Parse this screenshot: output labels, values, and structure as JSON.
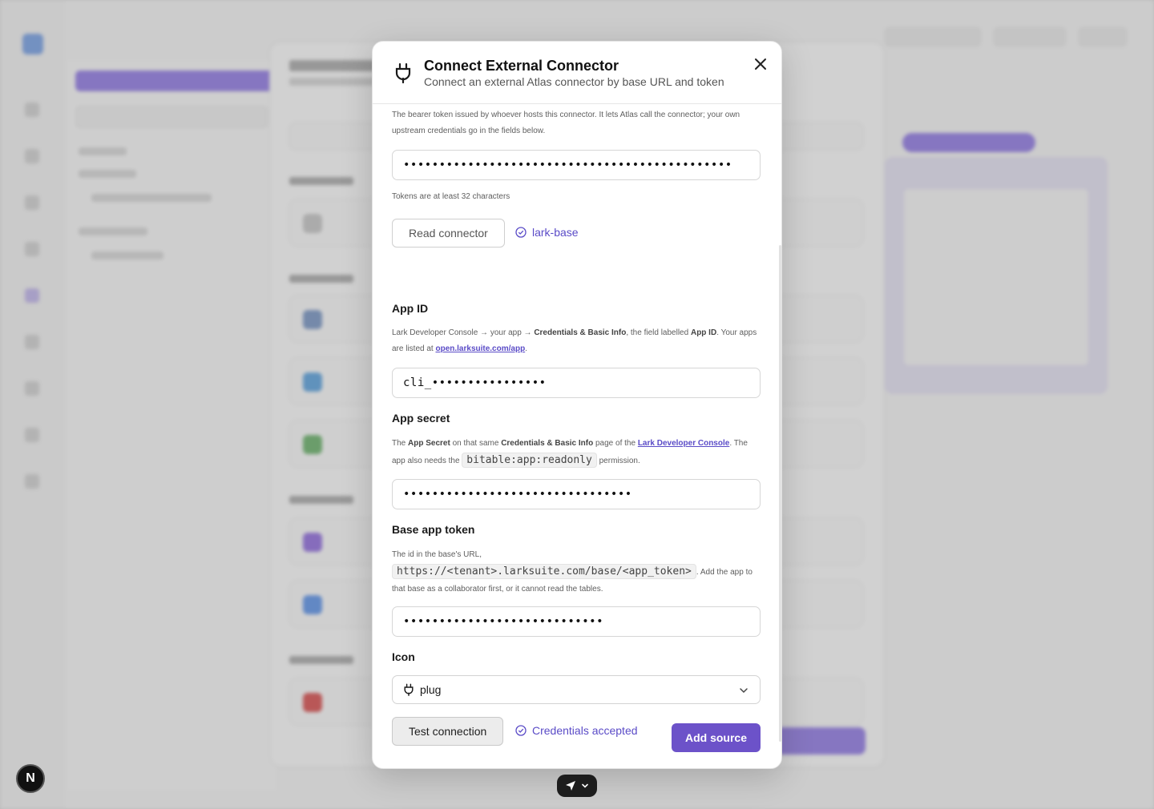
{
  "modal": {
    "title": "Connect External Connector",
    "subtitle": "Connect an external Atlas connector by base URL and token",
    "token": {
      "help": "The bearer token issued by whoever hosts this connector. It lets Atlas call the connector; your own upstream credentials go in the fields below.",
      "value": "••••••••••••••••••••••••••••••••••••••••••••••",
      "hint": "Tokens are at least 32 characters"
    },
    "read_button": "Read connector",
    "read_status": "lark-base",
    "app_id": {
      "label": "App ID",
      "help_a": "Lark Developer Console → your app → ",
      "help_b": "Credentials & Basic Info",
      "help_c": ", the field labelled ",
      "help_d": "App ID",
      "help_e": ". Your apps are listed at ",
      "help_link": "open.larksuite.com/app",
      "help_f": ".",
      "value": "cli_••••••••••••••••"
    },
    "app_secret": {
      "label": "App secret",
      "help_a": "The ",
      "help_b": "App Secret",
      "help_c": " on that same ",
      "help_d": "Credentials & Basic Info",
      "help_e": " page of the ",
      "help_link": "Lark Developer Console",
      "help_f": ". The app also needs the ",
      "help_code": "bitable:app:readonly",
      "help_g": " permission.",
      "value": "••••••••••••••••••••••••••••••••"
    },
    "base_token": {
      "label": "Base app token",
      "help_a": "The id in the base's URL, ",
      "help_code": "https://<tenant>.larksuite.com/base/<app_token>",
      "help_b": ". Add the app to that base as a collaborator first, or it cannot read the tables.",
      "value": "••••••••••••••••••••••••••••"
    },
    "icon": {
      "label": "Icon",
      "selected": "plug"
    },
    "test_button": "Test connection",
    "test_status": "Credentials accepted",
    "submit": "Add source"
  },
  "background": {
    "badge": "N"
  },
  "colors": {
    "accent": "#6c52c9",
    "status": "#5a4bc7"
  }
}
